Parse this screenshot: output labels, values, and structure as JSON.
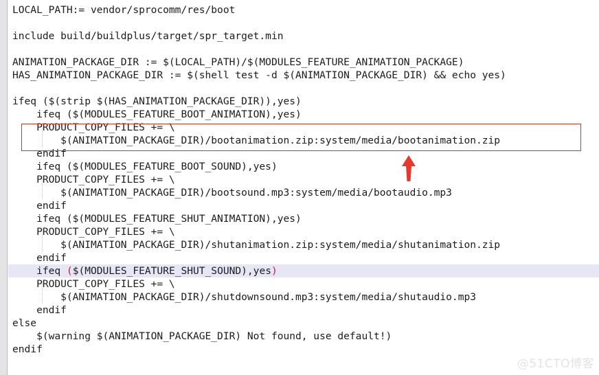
{
  "editor": {
    "language": "makefile",
    "background_color": "#ffffff",
    "text_color": "#1c1c1c",
    "gutter_color": "#e4e4e4",
    "highlight_line_color": "#e6e6f7",
    "annotation_color": "#c0392b",
    "bracket_match_color": "#c0213a"
  },
  "lines": [
    {
      "indent": 0,
      "text": "LOCAL_PATH:= vendor/sprocomm/res/boot"
    },
    {
      "indent": 0,
      "text": ""
    },
    {
      "indent": 0,
      "text": "include build/buildplus/target/spr_target.min"
    },
    {
      "indent": 0,
      "text": ""
    },
    {
      "indent": 0,
      "text": "ANIMATION_PACKAGE_DIR := $(LOCAL_PATH)/$(MODULES_FEATURE_ANIMATION_PACKAGE)"
    },
    {
      "indent": 0,
      "text": "HAS_ANIMATION_PACKAGE_DIR := $(shell test -d $(ANIMATION_PACKAGE_DIR) && echo yes)"
    },
    {
      "indent": 0,
      "text": ""
    },
    {
      "indent": 0,
      "text": "ifeq ($(strip $(HAS_ANIMATION_PACKAGE_DIR)),yes)"
    },
    {
      "indent": 0,
      "text": "    ifeq ($(MODULES_FEATURE_BOOT_ANIMATION),yes)"
    },
    {
      "indent": 0,
      "text": "    PRODUCT_COPY_FILES += \\"
    },
    {
      "indent": 0,
      "text": "        $(ANIMATION_PACKAGE_DIR)/bootanimation.zip:system/media/bootanimation.zip"
    },
    {
      "indent": 0,
      "text": "    endif"
    },
    {
      "indent": 0,
      "text": "    ifeq ($(MODULES_FEATURE_BOOT_SOUND),yes)"
    },
    {
      "indent": 0,
      "text": "    PRODUCT_COPY_FILES += \\"
    },
    {
      "indent": 0,
      "text": "        $(ANIMATION_PACKAGE_DIR)/bootsound.mp3:system/media/bootaudio.mp3"
    },
    {
      "indent": 0,
      "text": "    endif"
    },
    {
      "indent": 0,
      "text": "    ifeq ($(MODULES_FEATURE_SHUT_ANIMATION),yes)"
    },
    {
      "indent": 0,
      "text": "    PRODUCT_COPY_FILES += \\"
    },
    {
      "indent": 0,
      "text": "        $(ANIMATION_PACKAGE_DIR)/shutanimation.zip:system/media/shutanimation.zip"
    },
    {
      "indent": 0,
      "text": "    endif"
    },
    {
      "indent": 0,
      "text": "    ifeq ($(MODULES_FEATURE_SHUT_SOUND),yes)"
    },
    {
      "indent": 0,
      "text": "    PRODUCT_COPY_FILES += \\"
    },
    {
      "indent": 0,
      "text": "        $(ANIMATION_PACKAGE_DIR)/shutdownsound.mp3:system/media/shutaudio.mp3"
    },
    {
      "indent": 0,
      "text": "    endif"
    },
    {
      "indent": 0,
      "text": "else"
    },
    {
      "indent": 0,
      "text": "    $(warning $(ANIMATION_PACKAGE_DIR) Not found, use default!)"
    },
    {
      "indent": 0,
      "text": "endif"
    }
  ],
  "highlighted_line": {
    "index": 20,
    "prefix": "    ifeq ",
    "open_paren": "(",
    "inner": "$(MODULES_FEATURE_SHUT_SOUND),yes",
    "close_paren": ")"
  },
  "annotations": {
    "box": {
      "name": "red-rectangle-highlight",
      "covers_lines": [
        "    PRODUCT_COPY_FILES += \\",
        "        $(ANIMATION_PACKAGE_DIR)/bootanimation.zip:system/media/bootanimation.zip"
      ]
    },
    "arrow": {
      "name": "red-up-arrow",
      "direction": "up"
    }
  },
  "watermark": {
    "text": "@51CTO博客"
  }
}
